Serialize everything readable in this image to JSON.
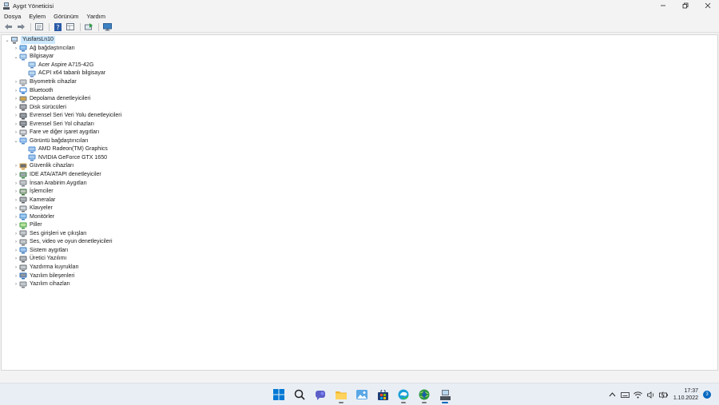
{
  "window": {
    "title": "Aygıt Yöneticisi"
  },
  "menu": [
    {
      "label": "Dosya"
    },
    {
      "label": "Eylem"
    },
    {
      "label": "Görünüm"
    },
    {
      "label": "Yardım"
    }
  ],
  "tree": {
    "root": "YusfarsLn10",
    "items": [
      {
        "label": "Ağ bağdaştırıcıları",
        "icon": "network-icon",
        "expanded": false
      },
      {
        "label": "Bilgisayar",
        "icon": "computer-icon",
        "expanded": true,
        "children": [
          "Acer Aspire A715-42G",
          "ACPI x64 tabanlı bilgisayar"
        ]
      },
      {
        "label": "Biyometrik cihazlar",
        "icon": "biometric-icon",
        "expanded": false
      },
      {
        "label": "Bluetooth",
        "icon": "bluetooth-icon",
        "expanded": false
      },
      {
        "label": "Depolama denetleyicileri",
        "icon": "storage-icon",
        "expanded": false
      },
      {
        "label": "Disk sürücüleri",
        "icon": "disk-icon",
        "expanded": false
      },
      {
        "label": "Evrensel Seri Veri Yolu denetleyicileri",
        "icon": "usb-icon",
        "expanded": false
      },
      {
        "label": "Evrensel Seri Yol cihazları",
        "icon": "usb-icon",
        "expanded": false
      },
      {
        "label": "Fare ve diğer işaret aygıtları",
        "icon": "mouse-icon",
        "expanded": false
      },
      {
        "label": "Görüntü bağdaştırıcıları",
        "icon": "display-adapter-icon",
        "expanded": true,
        "children": [
          "AMD Radeon(TM) Graphics",
          "NVIDIA GeForce GTX 1650"
        ]
      },
      {
        "label": "Güvenlik cihazları",
        "icon": "security-icon",
        "expanded": false
      },
      {
        "label": "IDE ATA/ATAPI denetleyiciler",
        "icon": "ide-icon",
        "expanded": false
      },
      {
        "label": "İnsan Arabirim Aygıtları",
        "icon": "hid-icon",
        "expanded": false
      },
      {
        "label": "İşlemciler",
        "icon": "processor-icon",
        "expanded": false
      },
      {
        "label": "Kameralar",
        "icon": "camera-icon",
        "expanded": false
      },
      {
        "label": "Klavyeler",
        "icon": "keyboard-icon",
        "expanded": false
      },
      {
        "label": "Monitörler",
        "icon": "monitor-icon",
        "expanded": false
      },
      {
        "label": "Piller",
        "icon": "battery-icon",
        "expanded": false
      },
      {
        "label": "Ses girişleri ve çıkışları",
        "icon": "audio-io-icon",
        "expanded": false
      },
      {
        "label": "Ses, video ve oyun denetleyicileri",
        "icon": "sound-icon",
        "expanded": false
      },
      {
        "label": "Sistem aygıtları",
        "icon": "system-icon",
        "expanded": false
      },
      {
        "label": "Üretici Yazılımı",
        "icon": "firmware-icon",
        "expanded": false
      },
      {
        "label": "Yazdırma kuyrukları",
        "icon": "printer-icon",
        "expanded": false
      },
      {
        "label": "Yazılım bileşenleri",
        "icon": "software-component-icon",
        "expanded": false
      },
      {
        "label": "Yazılım cihazları",
        "icon": "software-device-icon",
        "expanded": false
      }
    ]
  },
  "taskbar": {
    "time": "17:37",
    "date": "1.10.2022",
    "notifications": "3"
  },
  "colors": {
    "accent": "#0067c0",
    "selection": "#cce8ff",
    "window_bg": "#f3f3f3",
    "taskbar_bg": "#e9eef5"
  }
}
